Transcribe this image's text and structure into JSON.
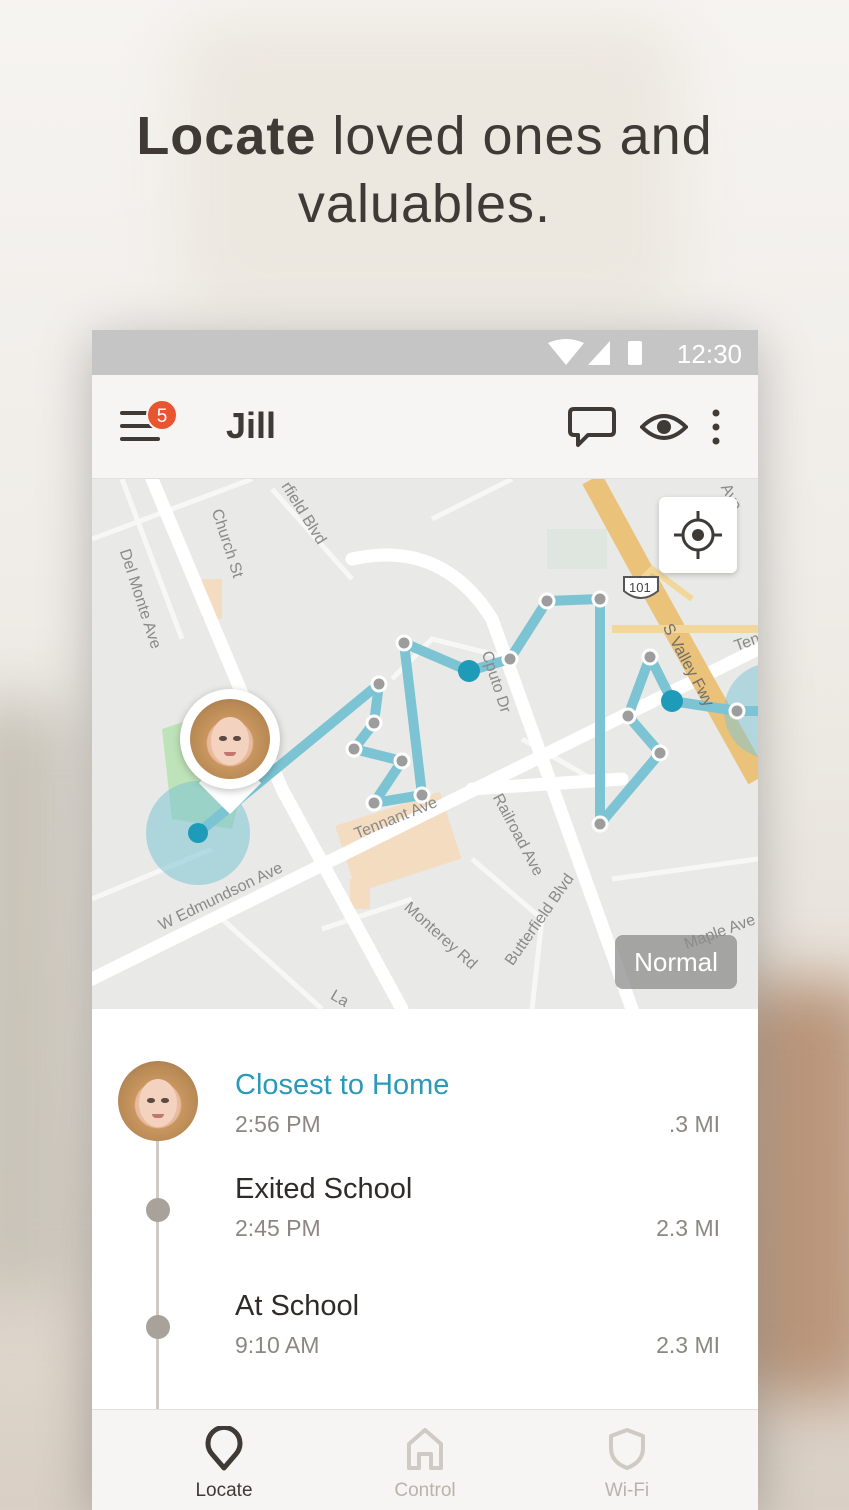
{
  "headline": {
    "bold": "Locate",
    "rest_line1": " loved ones and",
    "line2": "valuables."
  },
  "status_bar": {
    "time": "12:30"
  },
  "app_bar": {
    "title": "Jill",
    "badge_count": "5"
  },
  "map": {
    "mode_button": "Normal",
    "street_labels": {
      "church": "Church St",
      "delmonte": "Del Monte Ave",
      "butterfield_top": "rfield Blvd",
      "cputo": "Cputo Dr",
      "svalley": "S Valley Fwy",
      "tennant": "Tennant Ave",
      "railroad": "Railroad Ave",
      "edmundson": "W Edmundson Ave",
      "monterey": "Monterey Rd",
      "butterfield_bottom": "Butterfield Blvd",
      "maple": "Maple Ave",
      "highway_shield": "101",
      "ave_top_right": "Ave",
      "ten_right": "Ten",
      "la": "La"
    }
  },
  "timeline": [
    {
      "title": "Closest to Home",
      "time": "2:56 PM",
      "distance": ".3 MI",
      "accent": true
    },
    {
      "title": "Exited School",
      "time": "2:45 PM",
      "distance": "2.3 MI",
      "accent": false
    },
    {
      "title": "At School",
      "time": "9:10 AM",
      "distance": "2.3 MI",
      "accent": false
    }
  ],
  "bottom_nav": [
    {
      "label": "Locate",
      "active": true
    },
    {
      "label": "Control",
      "active": false
    },
    {
      "label": "Wi-Fi",
      "active": false
    }
  ],
  "colors": {
    "accent": "#2a9ab8",
    "route": "#7cc4d3",
    "badge": "#e8552f",
    "status_bar": "#c5c5c5"
  }
}
